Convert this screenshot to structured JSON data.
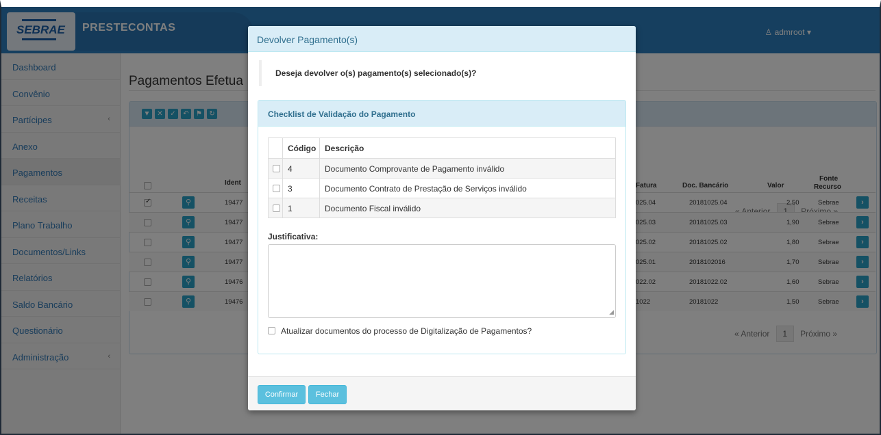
{
  "header": {
    "logo_text": "SEBRAE",
    "app_name": "PRESTECONTAS",
    "user": "admroot ▾"
  },
  "sidebar": {
    "items": [
      {
        "label": "Dashboard"
      },
      {
        "label": "Convênio"
      },
      {
        "label": "Partícipes",
        "chevron": "‹"
      },
      {
        "label": "Anexo"
      },
      {
        "label": "Pagamentos"
      },
      {
        "label": "Receitas"
      },
      {
        "label": "Plano Trabalho"
      },
      {
        "label": "Documentos/Links"
      },
      {
        "label": "Relatórios"
      },
      {
        "label": "Saldo Bancário"
      },
      {
        "label": "Questionário"
      },
      {
        "label": "Administração",
        "chevron": "‹"
      }
    ]
  },
  "main": {
    "title": "Pagamentos Efetua",
    "pager": {
      "prev": "« Anterior",
      "page": "1",
      "next": "Próximo »"
    },
    "columns": {
      "ident": "Ident",
      "fatura": "Fatura",
      "doc_bancario": "Doc. Bancário",
      "valor": "Valor",
      "fonte": "Fonte",
      "recurso": "Recurso"
    },
    "rows": [
      {
        "ident": "19477",
        "fatura": "025.04",
        "doc": "20181025.04",
        "valor": "2,50",
        "fonte": "Sebrae",
        "checked": true
      },
      {
        "ident": "19477",
        "fatura": "025.03",
        "doc": "20181025.03",
        "valor": "1,90",
        "fonte": "Sebrae",
        "checked": false
      },
      {
        "ident": "19477",
        "fatura": "025.02",
        "doc": "20181025.02",
        "valor": "1,80",
        "fonte": "Sebrae",
        "checked": false
      },
      {
        "ident": "19477",
        "fatura": "025.01",
        "doc": "2018102016",
        "valor": "1,70",
        "fonte": "Sebrae",
        "checked": false
      },
      {
        "ident": "19476",
        "fatura": "022.02",
        "doc": "20181022.02",
        "valor": "1,60",
        "fonte": "Sebrae",
        "checked": false
      },
      {
        "ident": "19476",
        "fatura": "1022",
        "doc": "20181022",
        "valor": "1,50",
        "fonte": "Sebrae",
        "checked": false
      }
    ]
  },
  "modal": {
    "title": "Devolver Pagamento(s)",
    "question": "Deseja devolver o(s) pagamento(s) selecionado(s)?",
    "checklist_title": "Checklist de Validação do Pagamento",
    "col_codigo": "Código",
    "col_descricao": "Descrição",
    "checklist": [
      {
        "codigo": "4",
        "descricao": "Documento Comprovante de Pagamento inválido"
      },
      {
        "codigo": "3",
        "descricao": "Documento Contrato de Prestação de Serviços inválido"
      },
      {
        "codigo": "1",
        "descricao": "Documento Fiscal inválido"
      }
    ],
    "justificativa_label": "Justificativa:",
    "atualizar_label": "Atualizar documentos do processo de Digitalização de Pagamentos?",
    "confirmar": "Confirmar",
    "fechar": "Fechar"
  },
  "colors": {
    "primary": "#2d7fbf",
    "info": "#5bc0de",
    "info_bg": "#d9edf7",
    "link": "#337ab7"
  }
}
